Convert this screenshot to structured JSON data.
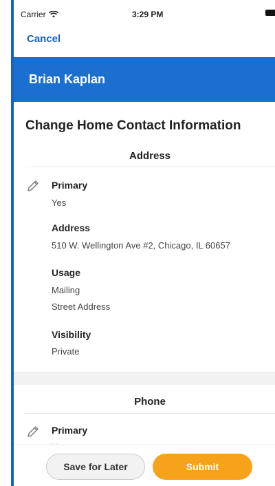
{
  "status_bar": {
    "carrier": "Carrier",
    "time": "3:29 PM"
  },
  "nav": {
    "cancel_label": "Cancel"
  },
  "header": {
    "name": "Brian Kaplan"
  },
  "page_title": "Change Home Contact Information",
  "address_section": {
    "title": "Address",
    "fields": [
      {
        "label": "Primary",
        "values": [
          "Yes"
        ]
      },
      {
        "label": "Address",
        "values": [
          "510 W. Wellington Ave #2, Chicago, IL 60657"
        ]
      },
      {
        "label": "Usage",
        "values": [
          "Mailing",
          "Street Address"
        ]
      },
      {
        "label": "Visibility",
        "values": [
          "Private"
        ]
      }
    ]
  },
  "phone_section": {
    "title": "Phone",
    "fields": [
      {
        "label": "Primary",
        "values": [
          "Yes"
        ]
      }
    ]
  },
  "actions": {
    "save_for_later": "Save for Later",
    "submit": "Submit"
  },
  "colors": {
    "primary_blue": "#1a6fd0",
    "submit_orange": "#f7a21b",
    "link_blue": "#1565c0"
  },
  "icons": {
    "edit": "pencil-icon",
    "wifi": "wifi-icon",
    "battery": "battery-icon"
  }
}
